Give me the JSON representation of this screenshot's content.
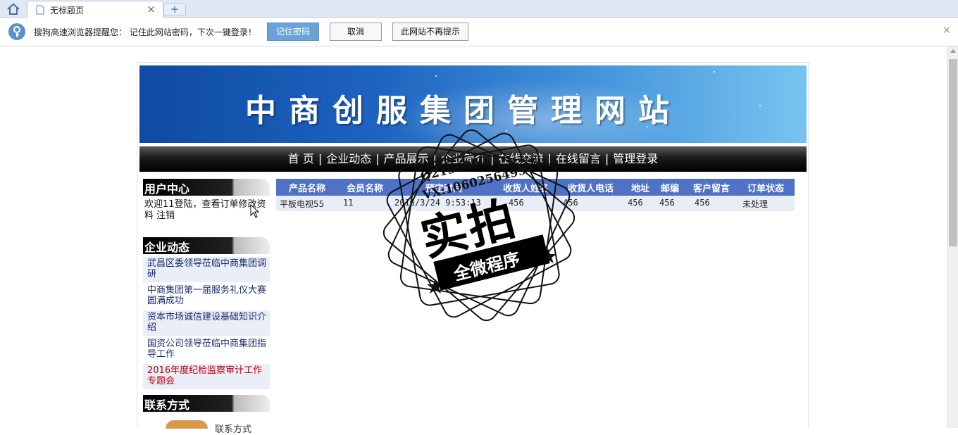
{
  "browser": {
    "tab_title": "无标题页",
    "tab_close": "×",
    "new_tab": "+"
  },
  "notify": {
    "message": "搜狗高速浏览器提醒您： 记住此网站密码，下次一键登录！",
    "remember_label": "记住密码",
    "cancel_label": "取消",
    "never_label": "此网站不再提示",
    "close_label": "×"
  },
  "site": {
    "banner_title": "中商创服集团管理网站"
  },
  "nav": {
    "items": [
      "首 页",
      "企业动态",
      "产品展示",
      "企业简介",
      "在线交流",
      "在线留言",
      "管理登录"
    ],
    "separator": "|"
  },
  "sidebar": {
    "user_center_title": "用户中心",
    "welcome_text": "欢迎11登陆，查看订单修改资料 注销",
    "news_title": "企业动态",
    "news": [
      "武昌区委领导莅临中商集团调研",
      "中商集团第一届服务礼仪大赛圆满成功",
      "资本市场诚信建设基础知识介绍",
      "国资公司领导莅临中商集团指导工作",
      "2016年度纪检监察审计工作专题会"
    ],
    "contact_title": "联系方式",
    "contact_caption": "联系方式"
  },
  "orders": {
    "headers": [
      "产品名称",
      "会员名称",
      "预定时间",
      "收货人姓名",
      "收货人电话",
      "地址",
      "邮编",
      "客户留言",
      "订单状态"
    ],
    "rows": [
      [
        "平板电视55",
        "11",
        "2016/3/24 9:53:13",
        "456",
        "456",
        "456",
        "456",
        "456",
        "未处理"
      ]
    ]
  },
  "watermark": {
    "line1": "Q2196060",
    "line2": "VX:1060256499",
    "big": "实拍",
    "band": "全微程序"
  },
  "colors": {
    "table_header": "#4f72c7",
    "nav_bg": "#000000",
    "remember_button": "#6aa3d8",
    "red_news": "#c0000c"
  }
}
